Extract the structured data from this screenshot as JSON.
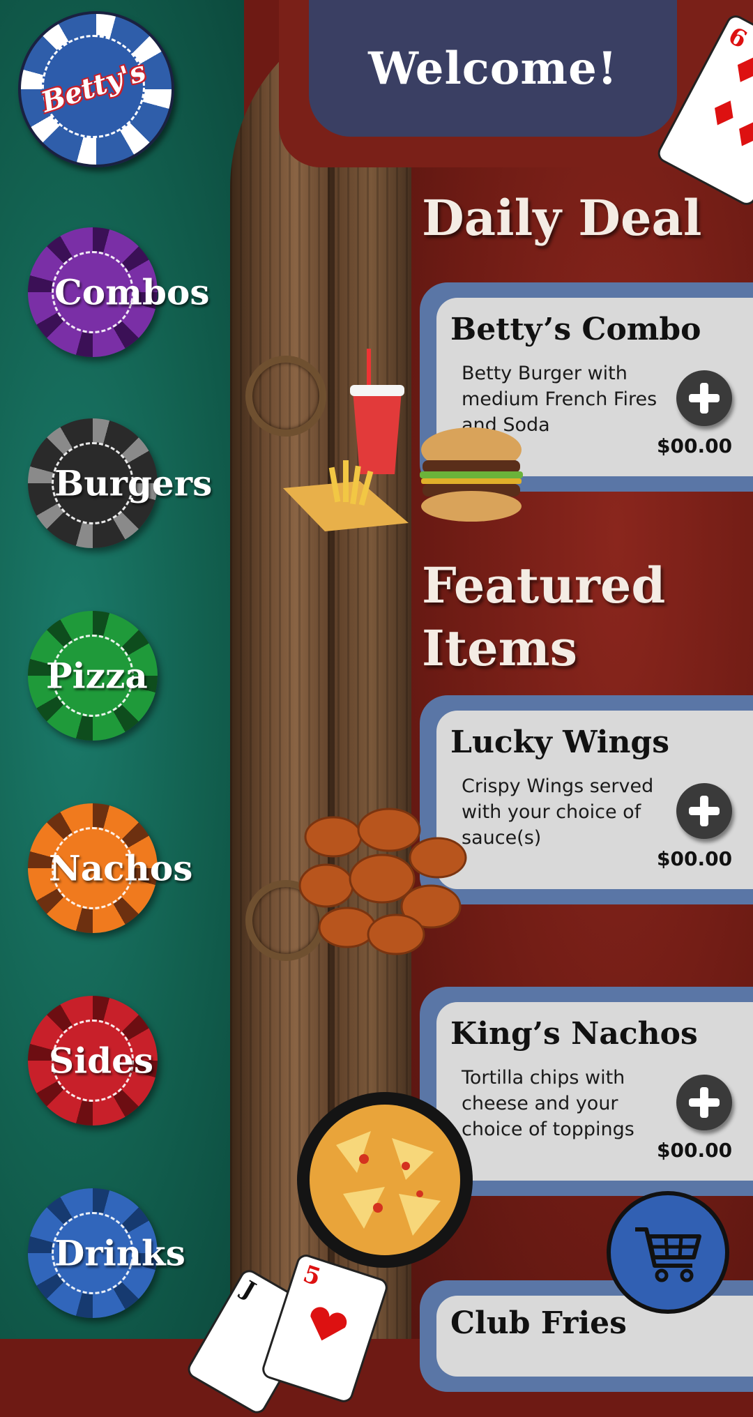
{
  "header": {
    "welcome": "Welcome!"
  },
  "logo": {
    "text": "Betty's"
  },
  "categories": [
    {
      "label": "Combos",
      "color": "#7a2fa6",
      "dark": "#3b1056"
    },
    {
      "label": "Burgers",
      "color": "#2a2a2a",
      "dark": "#8a8a8a"
    },
    {
      "label": "Pizza",
      "color": "#1f9a3a",
      "dark": "#0e4d1d"
    },
    {
      "label": "Nachos",
      "color": "#f07a1e",
      "dark": "#6d3010"
    },
    {
      "label": "Sides",
      "color": "#c8202a",
      "dark": "#6d0e12"
    },
    {
      "label": "Drinks",
      "color": "#3166bb",
      "dark": "#163a70"
    }
  ],
  "sections": {
    "daily_deal": "Daily Deal",
    "featured_line1": "Featured",
    "featured_line2": "Items"
  },
  "items": [
    {
      "name": "Betty’s Combo",
      "desc": "Betty Burger with medium French Fires and Soda",
      "price": "$00.00"
    },
    {
      "name": "Lucky Wings",
      "desc": "Crispy Wings served with your choice of sauce(s)",
      "price": "$00.00"
    },
    {
      "name": "King’s Nachos",
      "desc": "Tortilla chips with cheese and your choice of toppings",
      "price": "$00.00"
    },
    {
      "name": "Club Fries",
      "desc": "",
      "price": ""
    }
  ],
  "playing_cards": {
    "top_right": "6",
    "bottom_left_a": "J",
    "bottom_left_b": "5"
  },
  "icons": {
    "add": "plus-icon",
    "cart": "shopping-cart-icon"
  }
}
